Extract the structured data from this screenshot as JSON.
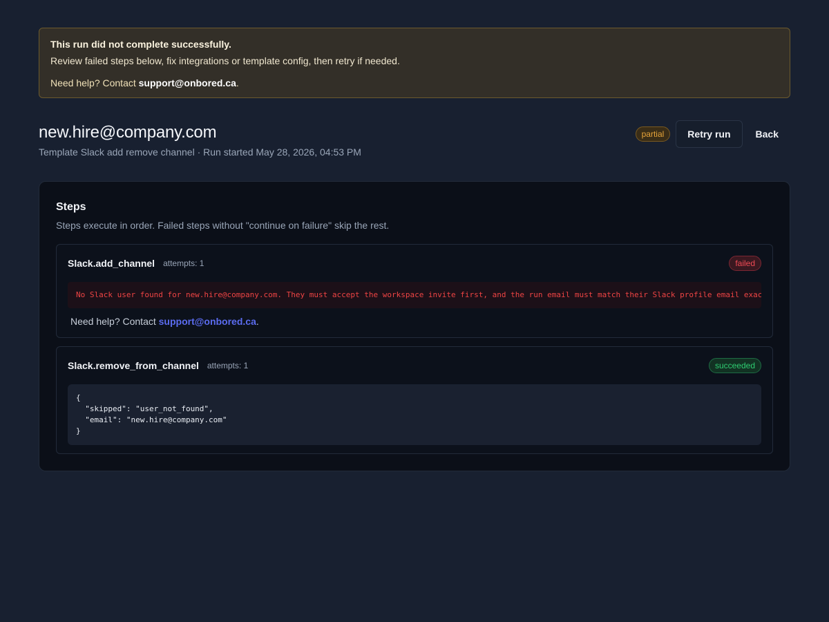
{
  "banner": {
    "title": "This run did not complete successfully.",
    "text": "Review failed steps below, fix integrations or template config, then retry if needed.",
    "help_prefix": "Need help? Contact ",
    "help_email": "support@onbored.ca",
    "help_suffix": "."
  },
  "header": {
    "title": "new.hire@company.com",
    "subtitle": "Template Slack add remove channel · Run started May 28, 2026, 04:53 PM",
    "status_badge": "partial",
    "retry_label": "Retry run",
    "back_label": "Back"
  },
  "steps_card": {
    "title": "Steps",
    "description": "Steps execute in order. Failed steps without \"continue on failure\" skip the rest."
  },
  "steps": [
    {
      "name": "Slack.add_channel",
      "attempts": "attempts: 1",
      "status": "failed",
      "error": "No Slack user found for new.hire@company.com. They must accept the workspace invite first, and the run email must match their Slack profile email exactly.",
      "help_prefix": "Need help? Contact ",
      "help_email": "support@onbored.ca",
      "help_suffix": "."
    },
    {
      "name": "Slack.remove_from_channel",
      "attempts": "attempts: 1",
      "status": "succeeded",
      "output": "{\n  \"skipped\": \"user_not_found\",\n  \"email\": \"new.hire@company.com\"\n}"
    }
  ],
  "colors": {
    "background": "#182030",
    "card": "#0b0f18",
    "warning_bg": "#332f28",
    "partial": "#e6a43a",
    "failed": "#ef4a55",
    "succeeded": "#2ecc71",
    "link": "#5b6cf0"
  }
}
